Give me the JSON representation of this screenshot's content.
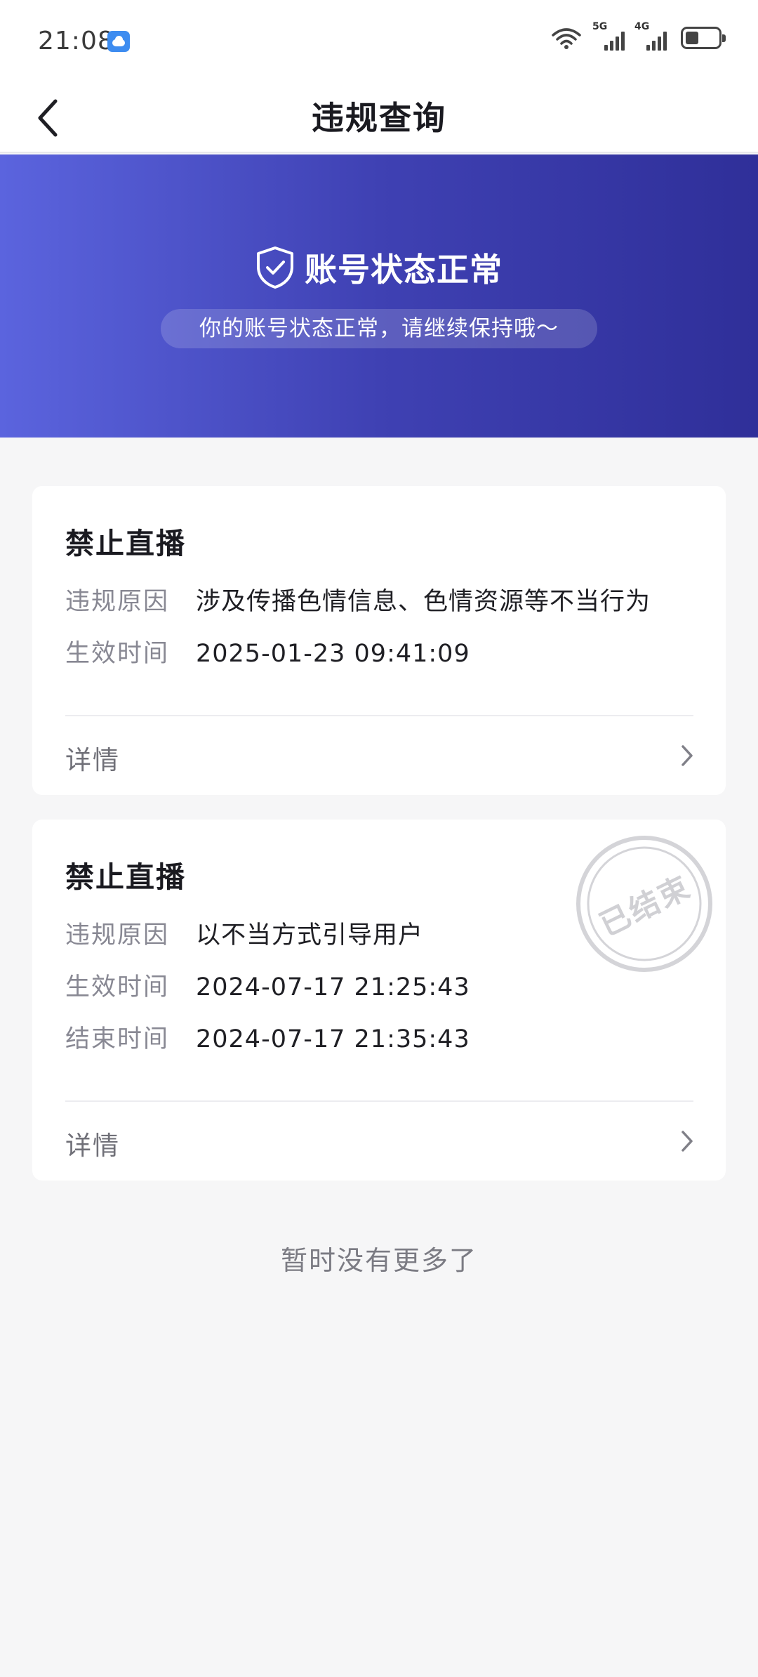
{
  "status_bar": {
    "time": "21:08",
    "icons": [
      "cloud-icon",
      "wifi-icon",
      "signal-5g-icon",
      "signal-4g-icon",
      "battery-icon"
    ],
    "network_5g": "5G",
    "network_4g": "4G",
    "battery_level": 0.4
  },
  "nav": {
    "title": "违规查询",
    "back_icon": "back-arrow-icon"
  },
  "banner": {
    "title": "账号状态正常",
    "subtitle": "你的账号状态正常，请继续保持哦～",
    "icon": "shield-check-icon",
    "gradient": [
      "#5b64de",
      "#2f2f99"
    ]
  },
  "records": [
    {
      "title": "禁止直播",
      "reason_label": "违规原因",
      "reason": "涉及传播色情信息、色情资源等不当行为",
      "start_label": "生效时间",
      "start": "2025-01-23 09:41:09",
      "detail_label": "详情"
    },
    {
      "title": "禁止直播",
      "reason_label": "违规原因",
      "reason": "以不当方式引导用户",
      "start_label": "生效时间",
      "start": "2024-07-17 21:25:43",
      "end_label": "结束时间",
      "end": "2024-07-17 21:35:43",
      "detail_label": "详情",
      "stamp": "已结束"
    }
  ],
  "footer": {
    "note": "暂时没有更多了"
  }
}
